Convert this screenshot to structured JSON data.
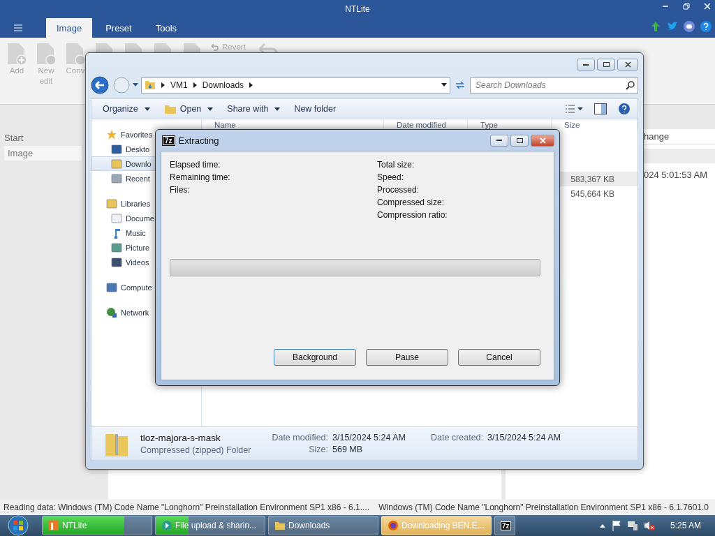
{
  "app": {
    "title": "NTLite",
    "tabs": [
      {
        "label": "Image",
        "selected": true
      },
      {
        "label": "Preset",
        "selected": false
      },
      {
        "label": "Tools",
        "selected": false
      }
    ],
    "ribbon": [
      {
        "kind": "add",
        "label": "Add"
      },
      {
        "kind": "new",
        "label": "New edit"
      },
      {
        "kind": "convert",
        "label": "Conv"
      },
      {
        "kind": "doc"
      },
      {
        "kind": "doc"
      },
      {
        "kind": "doc"
      },
      {
        "kind": "doc"
      },
      {
        "kind": "revert",
        "label": "Revert"
      },
      {
        "kind": "undo"
      }
    ],
    "left_panel": {
      "heading": "Start",
      "items": [
        {
          "label": "Image",
          "selected": true
        }
      ]
    },
    "right_panel": {
      "column_1": "hange",
      "rows": [
        {
          "selected": true
        },
        {
          "column_1": "024 5:01:53 AM",
          "selected": false
        }
      ]
    },
    "status_bar": [
      "Reading data: Windows (TM) Code Name \"Longhorn\" Preinstallation Environment SP1 x86 - 6.1....",
      "Windows (TM) Code Name \"Longhorn\" Preinstallation Environment SP1 x86 - 6.1.7601.0"
    ]
  },
  "explorer": {
    "address": [
      "VM1",
      "Downloads"
    ],
    "search": {
      "placeholder": "Search Downloads"
    },
    "toolbar": [
      {
        "label": "Organize",
        "dropdown": true
      },
      {
        "label": "Open",
        "dropdown": true,
        "kind": "open"
      },
      {
        "label": "Share with",
        "dropdown": true
      },
      {
        "label": "New folder",
        "dropdown": false
      }
    ],
    "nav": [
      {
        "label": "Favorites",
        "kind": "star",
        "children": [
          {
            "label": "Deskto",
            "kind": "desktop",
            "selected": false
          },
          {
            "label": "Downlo",
            "kind": "downloads",
            "selected": true
          },
          {
            "label": "Recent",
            "kind": "recent",
            "selected": false
          }
        ]
      },
      {
        "label": "Libraries",
        "kind": "library",
        "children": [
          {
            "label": "Docume",
            "kind": "document",
            "selected": false
          },
          {
            "label": "Music",
            "kind": "music",
            "selected": false
          },
          {
            "label": "Picture",
            "kind": "pictures",
            "selected": false
          },
          {
            "label": "Videos",
            "kind": "videos",
            "selected": false
          }
        ]
      },
      {
        "label": "Compute",
        "kind": "computer"
      },
      {
        "label": "Network",
        "kind": "network"
      }
    ],
    "columns": [
      "Name",
      "Date modified",
      "Type",
      "Size"
    ],
    "rows": [
      {
        "size": "583,367 KB",
        "selected": true
      },
      {
        "size": "545,664 KB",
        "selected": false
      }
    ],
    "details": {
      "name": "tloz-majora-s-mask",
      "type": "Compressed (zipped) Folder",
      "fields": [
        {
          "label": "Date modified:",
          "value": "3/15/2024 5:24 AM"
        },
        {
          "label": "Date created:",
          "value": "3/15/2024 5:24 AM"
        },
        {
          "label": "Size:",
          "value": "569 MB"
        }
      ]
    }
  },
  "dialog": {
    "icon_label": "7z",
    "title": "Extracting",
    "progress": {
      "level": 0
    },
    "left_labels": [
      "Elapsed time:",
      "Remaining time:",
      "Files:"
    ],
    "right_labels": [
      "Total size:",
      "Speed:",
      "Processed:",
      "Compressed size:",
      "Compression ratio:"
    ],
    "buttons": [
      "Background",
      "Pause",
      "Cancel"
    ]
  },
  "taskbar": {
    "items": [
      {
        "label": "NTLite",
        "kind": "ntlite",
        "level": 0.75,
        "highlighted": false
      },
      {
        "label": "File upload & sharin...",
        "kind": "upload",
        "level": 0.3,
        "highlighted": false
      },
      {
        "label": "Downloads",
        "kind": "folder",
        "highlighted": false
      },
      {
        "label": "Downloading BEN.E...",
        "kind": "firefox",
        "highlighted": true
      },
      {
        "kind": "sevenzip",
        "label": "7z",
        "highlighted": false
      }
    ],
    "clock": "5:25 AM"
  }
}
